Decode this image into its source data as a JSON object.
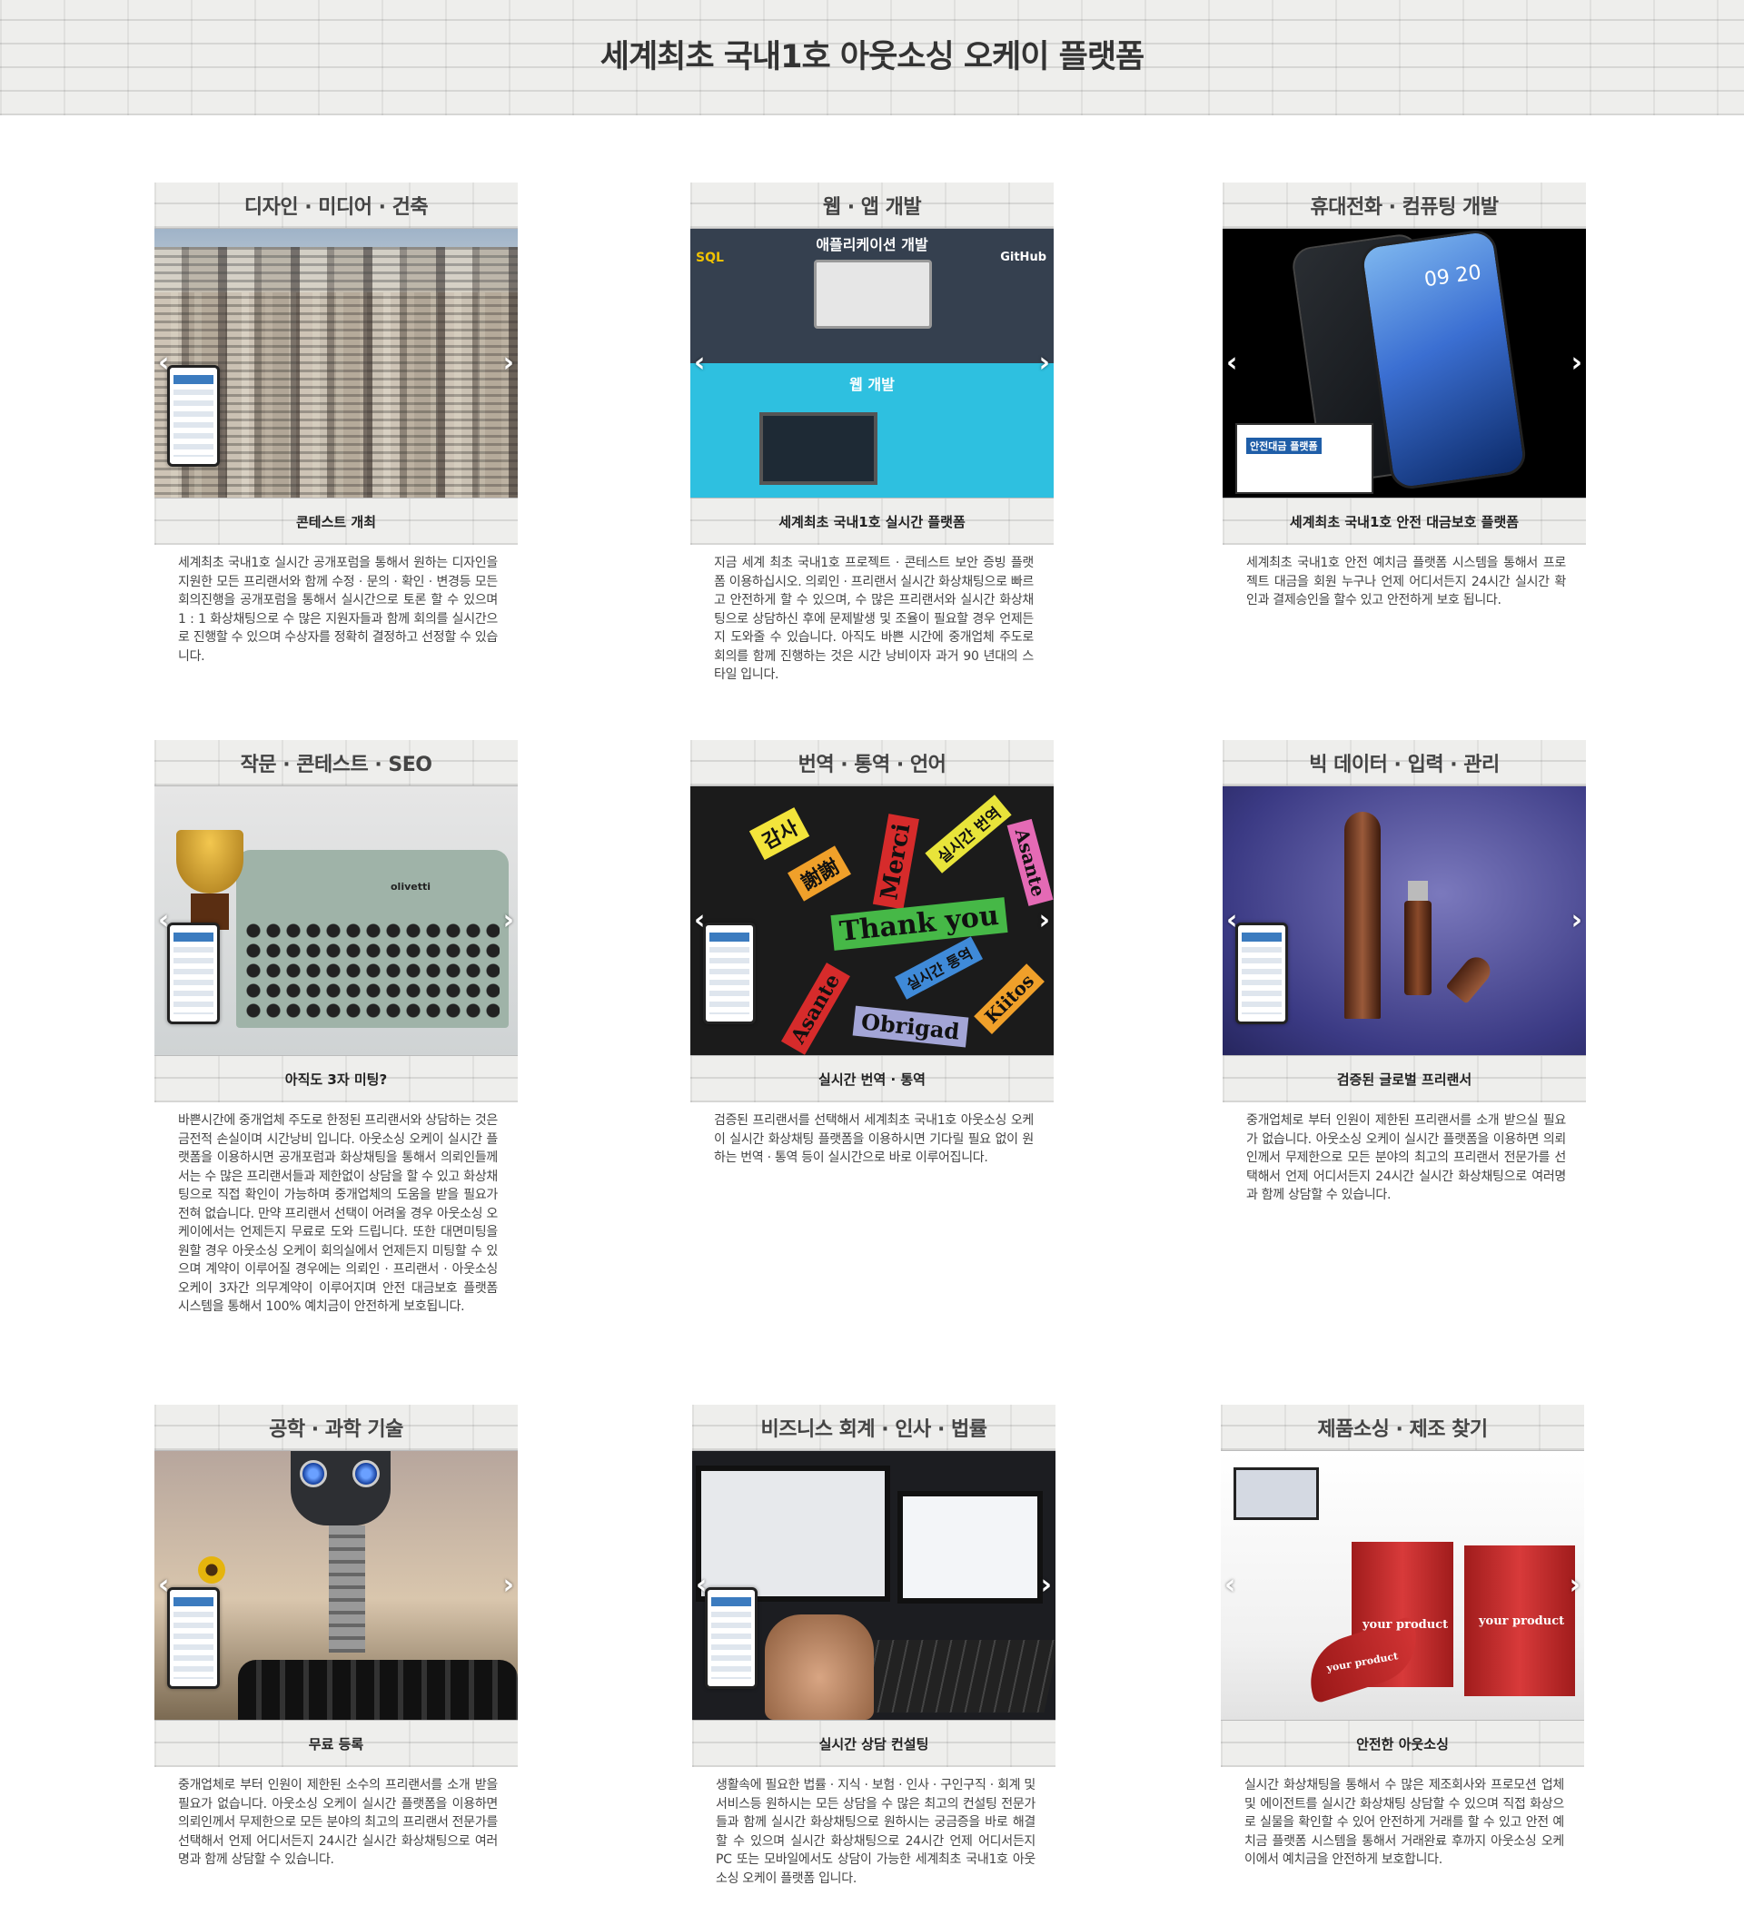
{
  "header": {
    "title": "세계최초 국내1호 아웃소싱 오케이 플랫폼"
  },
  "cards": [
    {
      "title": "디자인 · 미디어 · 건축",
      "caption": "콘테스트 개최",
      "desc": "세계최초 국내1호 실시간 공개포럼을 통해서 원하는 디자인을 지원한 모든 프리랜서와 함께 수정 · 문의 · 확인 · 변경등 모든 회의진행을 공개포럼을 통해서 실시간으로 토론 할 수 있으며 1 : 1 화상채팅으로 수 많은 지원자들과 함께 회의를 실시간으로 진행할 수 있으며 수상자를 정확히 결정하고 선정할 수 있습니다."
    },
    {
      "title": "웹 · 앱 개발",
      "caption": "세계최초 국내1호 실시간 플랫폼",
      "image_labels": {
        "top": "애플리케이션 개발",
        "bottom": "웹 개발",
        "left": "SQL",
        "right": "GitHub"
      },
      "desc": "지금 세계 최초 국내1호 프로젝트 · 콘테스트 보안 증빙 플랫폼 이용하십시오. 의뢰인 · 프리랜서 실시간 화상채팅으로 빠르고 안전하게 할 수 있으며, 수 많은 프리랜서와 실시간 화상채팅으로 상담하신 후에 문제발생 및 조율이 필요할 경우 언제든지 도와줄 수 있습니다. 아직도 바쁜 시간에 중개업체 주도로 회의를 함께 진행하는 것은 시간 낭비이자 과거 90 년대의 스타일 입니다."
    },
    {
      "title": "휴대전화 · 컴퓨팅 개발",
      "caption": "세계최초 국내1호 안전 대금보호 플랫폼",
      "image_labels": {
        "time": "09 20",
        "overlay": "안전대금 플랫폼"
      },
      "desc": "세계최초 국내1호 안전 예치금 플랫폼 시스템을 통해서 프로젝트 대금을 회원 누구나 언제 어디서든지 24시간 실시간 확인과 결제승인을 할수 있고 안전하게 보호 됩니다."
    },
    {
      "title": "작문 · 콘테스트 · SEO",
      "caption": "아직도 3자 미팅?",
      "image_labels": {
        "brand": "olivetti"
      },
      "desc": "바쁜시간에 중개업체 주도로 한정된 프리랜서와 상담하는 것은 금전적 손실이며 시간낭비 입니다. 아웃소싱 오케이 실시간 플랫폼을 이용하시면 공개포럼과 화상채팅을 통해서 의뢰인들께서는 수 많은 프리랜서들과 제한없이 상담을 할 수 있고 화상채팅으로 직접 확인이 가능하며 중개업체의 도움을 받을 필요가 전혀 없습니다. 만약 프리랜서 선택이 어려울 경우 아웃소싱 오케이에서는 언제든지 무료로 도와 드립니다. 또한 대면미팅을 원할 경우 아웃소싱 오케이 회의실에서 언제든지 미팅할 수 있으며 계약이 이루어질 경우에는 의뢰인 · 프리랜서 · 아웃소싱 오케이 3자간 의무계약이 이루어지며 안전 대금보호 플랫폼 시스템을 통해서 100% 예치금이 안전하게 보호됩니다."
    },
    {
      "title": "번역 · 통역 · 언어",
      "caption": "실시간 번역 · 통역",
      "image_labels": {
        "w1": "감사",
        "w2": "謝謝",
        "w3": "Merci",
        "w4": "실시간 번역",
        "w5": "Thank you",
        "w6": "Asante",
        "w7": "실시간 통역",
        "w8": "Obrigad",
        "w9": "Kiitos",
        "w10": "Asante"
      },
      "desc": "검증된 프리랜서를 선택해서 세계최초 국내1호 아웃소싱 오케이 실시간 화상채팅 플랫폼을 이용하시면 기다릴 필요 없이 원하는 번역 · 통역 등이 실시간으로 바로 이루어집니다."
    },
    {
      "title": "빅 데이터 · 입력 · 관리",
      "caption": "검증된 글로벌 프리랜서",
      "desc": "중개업체로 부터 인원이 제한된 프리랜서를 소개 받으실 필요가 없습니다. 아웃소싱 오케이 실시간 플랫폼을 이용하면 의뢰인께서 무제한으로 모든 분야의 최고의 프리랜서 전문가를 선택해서 언제 어디서든지 24시간 실시간 화상채팅으로 여러명과 함께 상담할 수 있습니다."
    },
    {
      "title": "공학 · 과학 기술",
      "caption": "무료 등록",
      "desc": "중개업체로 부터 인원이 제한된 소수의 프리랜서를 소개 받을 필요가 없습니다. 아웃소싱 오케이 실시간 플랫폼을 이용하면 의뢰인께서 무제한으로 모든 분야의 최고의 프리랜서 전문가를 선택해서 언제 어디서든지 24시간 실시간 화상채팅으로 여러명과 함께 상담할 수 있습니다."
    },
    {
      "title": "비즈니스 회계 · 인사 · 법률",
      "caption": "실시간 상담 컨설팅",
      "desc": "생활속에 필요한 법률 · 지식 · 보험 · 인사 · 구인구직 · 회계 및 서비스등 원하시는 모든 상담을 수 많은 최고의 컨설팅 전문가들과 함께 실시간 화상채팅으로 원하시는 궁금증을 바로 해결할 수 있으며 실시간 화상채팅으로 24시간 언제 어디서든지 PC 또는 모바일에서도 상담이 가능한 세계최초 국내1호 아웃소싱 오케이 플랫폼 입니다."
    },
    {
      "title": "제품소싱 · 제조 찾기",
      "caption": "안전한 아웃소싱",
      "image_labels": {
        "p1": "your product",
        "p2": "your product",
        "p3": "your product"
      },
      "desc": "실시간 화상채팅을 통해서 수 많은 제조회사와 프로모션 업체 및 에이전트를 실시간 화상채팅 상담할 수 있으며 직접 화상으로 실물을 확인할 수 있어 안전하게 거래를 할 수 있고 안전 예치금 플랫폼 시스템을 통해서 거래완료 후까지 아웃소싱 오케이에서 예치금을 안전하게 보호합니다."
    }
  ],
  "carousel": {
    "prev_icon": "‹",
    "next_icon": "›"
  }
}
